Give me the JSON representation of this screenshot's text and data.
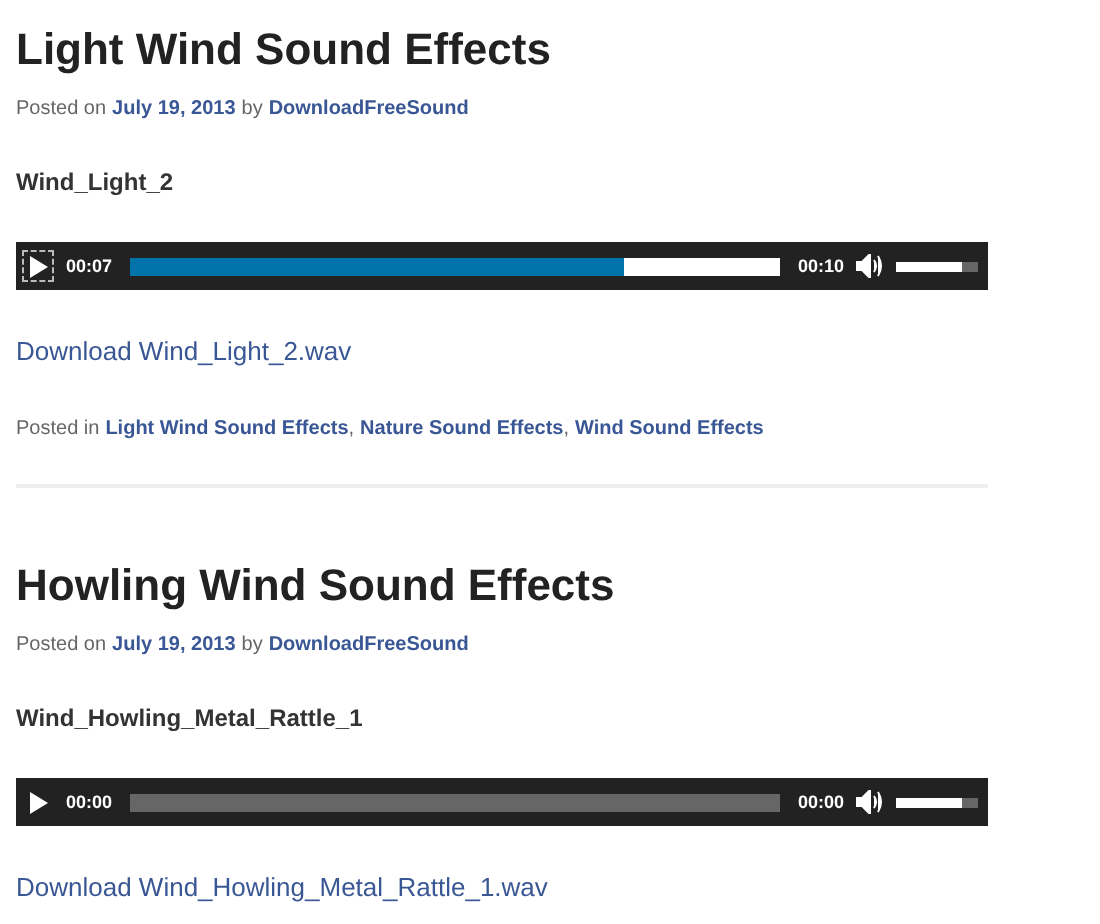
{
  "posts": [
    {
      "title": "Light Wind Sound Effects",
      "meta": {
        "prefix": "Posted on",
        "date": "July 19, 2013",
        "by": "by",
        "author": "DownloadFreeSound"
      },
      "track": "Wind_Light_2",
      "player": {
        "focused": true,
        "elapsed": "00:07",
        "level": 0.76,
        "loaded": true,
        "duration": "00:10",
        "volume": {
          "level": 0.8
        }
      },
      "download": "Download Wind_Light_2.wav",
      "categories": {
        "prefix": "Posted in",
        "items": [
          {
            "label": "Light Wind Sound Effects",
            "sep": ","
          },
          {
            "label": "Nature Sound Effects",
            "sep": ","
          },
          {
            "label": "Wind Sound Effects"
          }
        ]
      }
    },
    {
      "title": "Howling Wind Sound Effects",
      "meta": {
        "prefix": "Posted on",
        "date": "July 19, 2013",
        "by": "by",
        "author": "DownloadFreeSound"
      },
      "track": "Wind_Howling_Metal_Rattle_1",
      "player": {
        "focused": false,
        "elapsed": "00:00",
        "level": 0,
        "loaded": false,
        "duration": "00:00",
        "volume": {
          "level": 0.8
        }
      },
      "download": "Download Wind_Howling_Metal_Rattle_1.wav"
    }
  ]
}
